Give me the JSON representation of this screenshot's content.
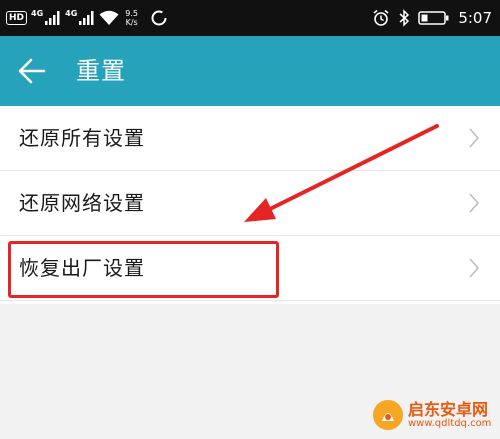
{
  "status_bar": {
    "hd": "HD",
    "net1": "4G",
    "net2": "4G",
    "speed_value": "9.5",
    "speed_unit": "K/s",
    "time": "5:07"
  },
  "app_bar": {
    "title": "重置",
    "background": "#27a2bb"
  },
  "list": {
    "items": [
      {
        "label": "还原所有设置"
      },
      {
        "label": "还原网络设置"
      },
      {
        "label": "恢复出厂设置"
      }
    ]
  },
  "annotation": {
    "color": "#e52524"
  },
  "watermark": {
    "line1": "启东安卓网",
    "line2": "www.qdltdq.com"
  }
}
